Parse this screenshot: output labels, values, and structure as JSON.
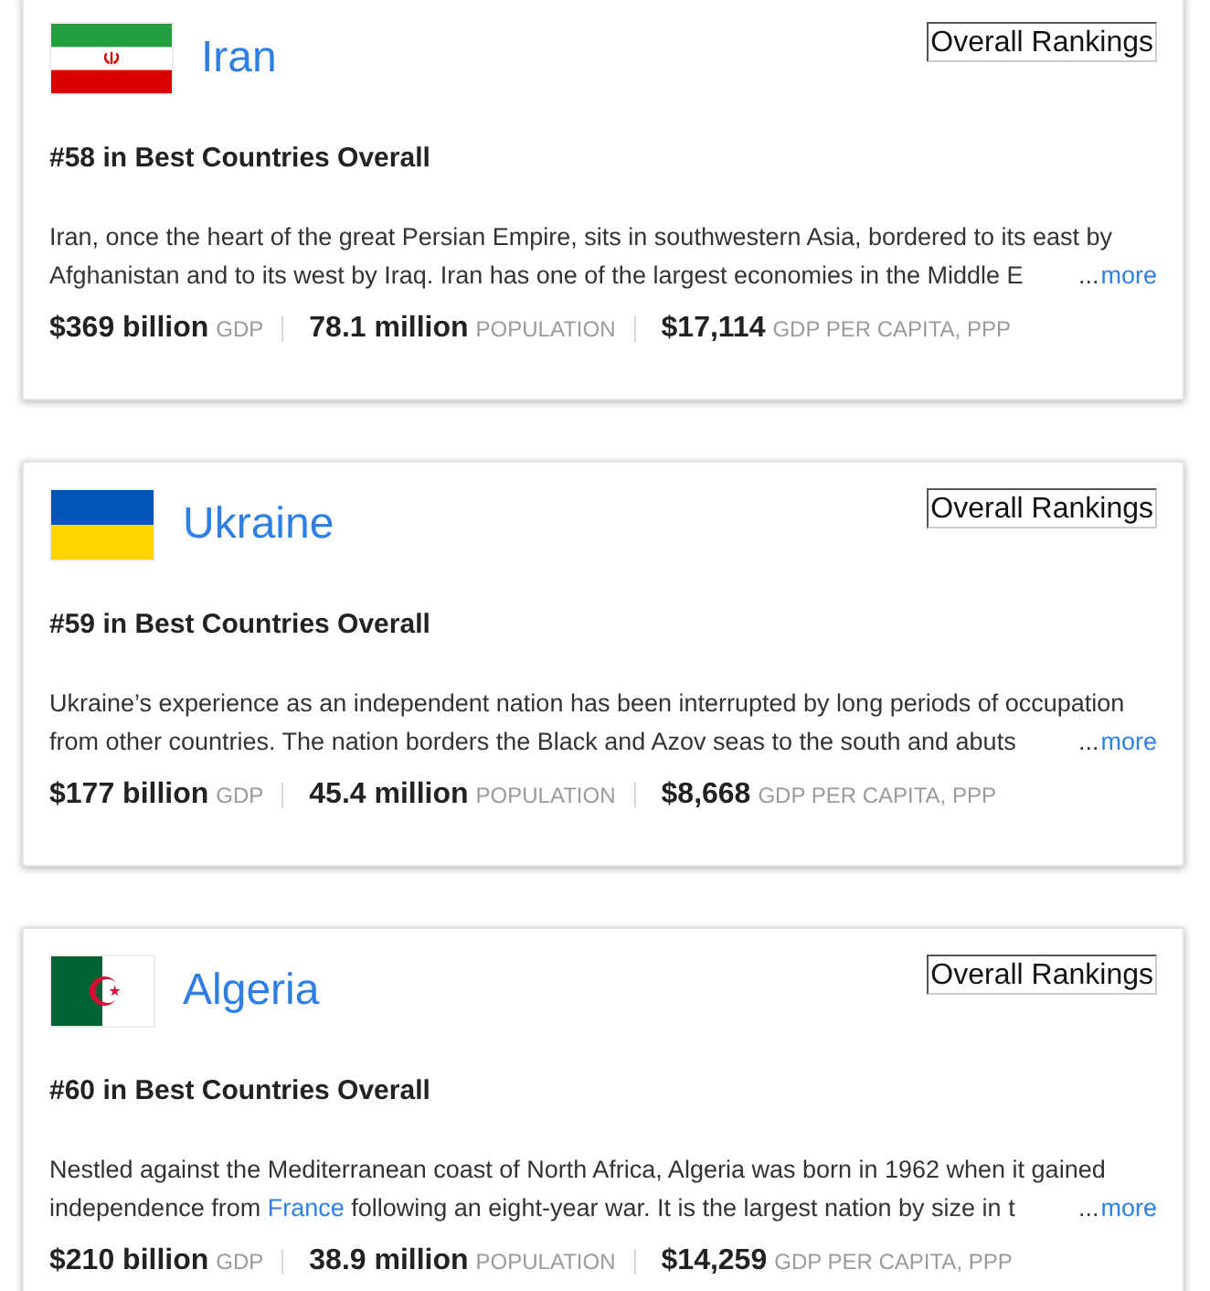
{
  "countries": [
    {
      "kind": "iran",
      "name": "Iran",
      "rankings_button": "Overall Rankings",
      "rank": "#58 in Best Countries Overall",
      "description": [
        {
          "kind": "text",
          "text": "Iran, once the heart of the great Persian Empire, sits in southwestern Asia, bordered to its east by Afghanistan and to its west by Iraq. Iran has one of the largest economies in the Middle E"
        }
      ],
      "ellipsis": "...",
      "more_link": "more",
      "stats": [
        {
          "value": "$369 billion",
          "label": "GDP"
        },
        {
          "value": "78.1 million",
          "label": "POPULATION"
        },
        {
          "value": "$17,114",
          "label": "GDP PER CAPITA, PPP"
        }
      ]
    },
    {
      "kind": "ukraine",
      "name": "Ukraine",
      "rankings_button": "Overall Rankings",
      "rank": "#59 in Best Countries Overall",
      "description": [
        {
          "kind": "text",
          "text": "Ukraine’s experience as an independent nation has been interrupted by long periods of occupation from other countries. The nation borders the Black and Azov seas to the south and abuts"
        }
      ],
      "ellipsis": "...",
      "more_link": "more",
      "stats": [
        {
          "value": "$177 billion",
          "label": "GDP"
        },
        {
          "value": "45.4 million",
          "label": "POPULATION"
        },
        {
          "value": "$8,668",
          "label": "GDP PER CAPITA, PPP"
        }
      ]
    },
    {
      "kind": "algeria",
      "name": "Algeria",
      "rankings_button": "Overall Rankings",
      "rank": "#60 in Best Countries Overall",
      "description": [
        {
          "kind": "text",
          "text": "Nestled against the Mediterranean coast of North Africa, Algeria was born in 1962 when it gained independence from "
        },
        {
          "kind": "link",
          "text": "France"
        },
        {
          "kind": "text",
          "text": " following an eight-year war. It is the largest nation by size in t"
        }
      ],
      "ellipsis": "...",
      "more_link": "more",
      "stats": [
        {
          "value": "$210 billion",
          "label": "GDP"
        },
        {
          "value": "38.9 million",
          "label": "POPULATION"
        },
        {
          "value": "$14,259",
          "label": "GDP PER CAPITA, PPP"
        }
      ]
    }
  ]
}
